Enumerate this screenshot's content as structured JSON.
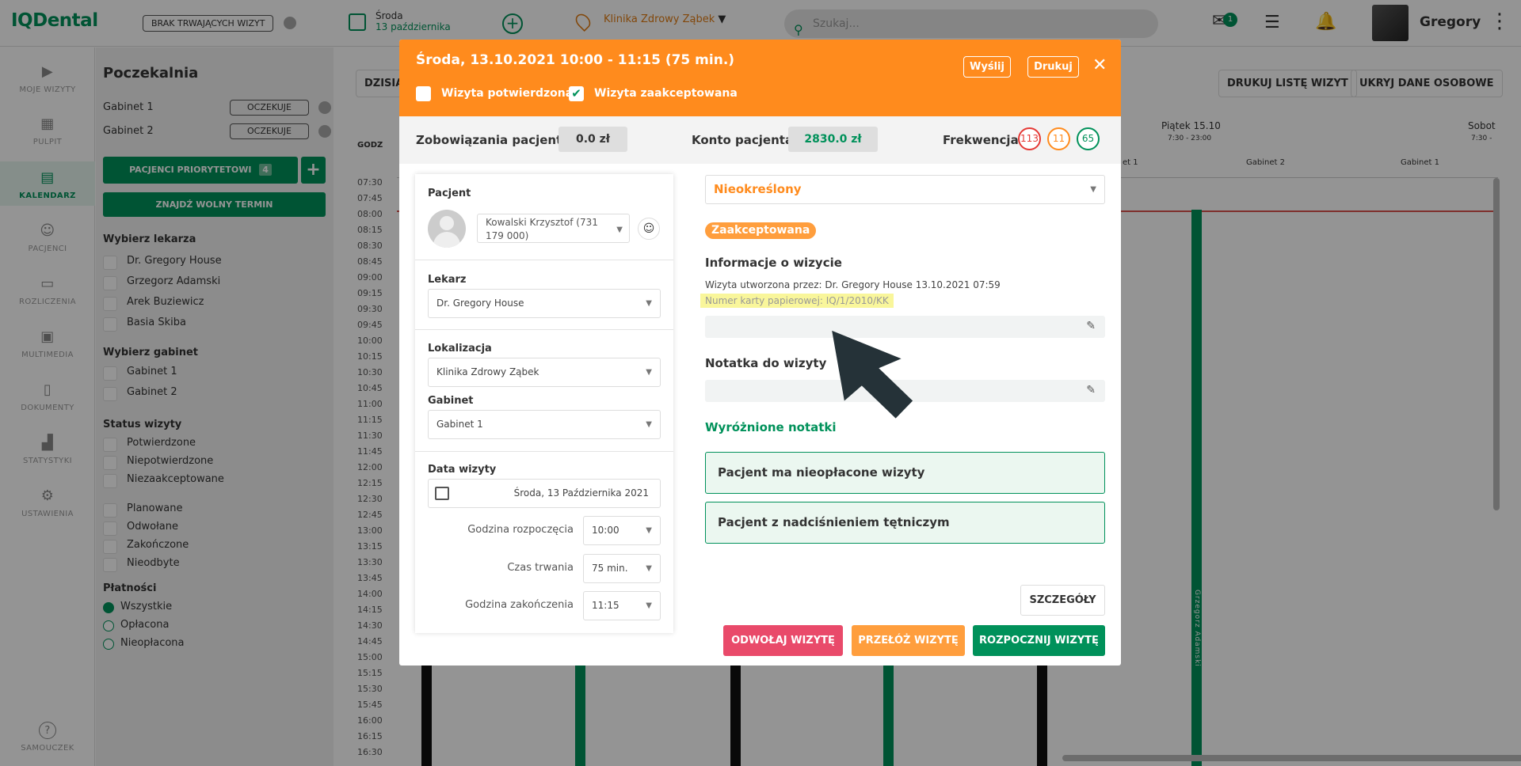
{
  "app": {
    "logo": "IQDental",
    "no_visits": "BRAK TRWAJĄCYCH WIZYT",
    "date_day": "Środa",
    "date_full": "13 października",
    "clinic": "Klinika Zdrowy Ząbek",
    "search_placeholder": "Szukaj...",
    "mail_count": "1",
    "user_name": "Gregory",
    "accent": "#00915a",
    "orange": "#ff8b1d"
  },
  "sidebar": {
    "items": [
      {
        "label": "MOJE WIZYTY",
        "icon": "play-icon"
      },
      {
        "label": "PULPIT",
        "icon": "dashboard-icon"
      },
      {
        "label": "KALENDARZ",
        "icon": "calendar-icon"
      },
      {
        "label": "PACJENCI",
        "icon": "patients-icon"
      },
      {
        "label": "ROZLICZENIA",
        "icon": "billing-icon"
      },
      {
        "label": "MULTIMEDIA",
        "icon": "media-icon"
      },
      {
        "label": "DOKUMENTY",
        "icon": "document-icon"
      },
      {
        "label": "STATYSTYKI",
        "icon": "stats-icon"
      },
      {
        "label": "USTAWIENIA",
        "icon": "gear-icon"
      }
    ],
    "help": "SAMOUCZEK"
  },
  "left_panel": {
    "title": "Poczekalnia",
    "rooms": [
      {
        "name": "Gabinet 1",
        "status": "OCZEKUJE"
      },
      {
        "name": "Gabinet 2",
        "status": "OCZEKUJE"
      }
    ],
    "priority_btn": "PACJENCI PRIORYTETOWI",
    "priority_count": "4",
    "free_btn": "ZNAJDŹ WOLNY TERMIN",
    "doctor_title": "Wybierz lekarza",
    "doctors": [
      "Dr. Gregory House",
      "Grzegorz Adamski",
      "Arek Buziewicz",
      "Basia Skiba"
    ],
    "room_title": "Wybierz gabinet",
    "room_filters": [
      "Gabinet 1",
      "Gabinet 2"
    ],
    "status_title": "Status wizyty",
    "statuses": [
      "Potwierdzone",
      "Niepotwierdzone",
      "Niezaakceptowane"
    ],
    "statuses2": [
      "Planowane",
      "Odwołane",
      "Zakończone",
      "Nieodbyte"
    ],
    "pay_title": "Płatności",
    "payments": [
      "Wszystkie",
      "Opłacona",
      "Nieopłacona"
    ]
  },
  "calendar": {
    "today_btn": "DZISIA",
    "godz": "GODZ",
    "print_btn": "DRUKUJ LISTĘ WIZYT",
    "hide_btn": "UKRYJ DANE OSOBOWE",
    "day_fri": "Piątek 15.10",
    "hours_fri": "7:30 - 23:00",
    "day_sat": "Sobot",
    "hours_sat": "7:30 -",
    "col1": "et 1",
    "col2": "Gabinet 2",
    "col3": "Gabinet 1",
    "vertical_name": "Grzegorz Adamski",
    "times": [
      "07:30",
      "07:45",
      "08:00",
      "08:15",
      "08:30",
      "08:45",
      "09:00",
      "09:15",
      "09:30",
      "09:45",
      "10:00",
      "10:15",
      "10:30",
      "10:45",
      "11:00",
      "11:15",
      "11:30",
      "11:45",
      "12:00",
      "12:15",
      "12:30",
      "12:45",
      "13:00",
      "13:15",
      "13:30",
      "13:45",
      "14:00",
      "14:15",
      "14:30",
      "14:45",
      "15:00",
      "15:15",
      "15:30",
      "15:45",
      "16:00",
      "16:15",
      "16:30"
    ]
  },
  "modal": {
    "title": "Środa, 13.10.2021 10:00 - 11:15 (75 min.)",
    "send": "Wyślij",
    "print": "Drukuj",
    "confirmed": "Wizyta potwierdzona",
    "accepted": "Wizyta zaakceptowana",
    "obligations_label": "Zobowiązania pacjenta",
    "obligations_value": "0.0 zł",
    "account_label": "Konto pacjenta",
    "account_value": "2830.0 zł",
    "attendance_label": "Frekwencja",
    "att_red": "113",
    "att_orange": "11",
    "att_green": "65",
    "patient_label": "Pacjent",
    "patient_value": "Kowalski Krzysztof (731 179 000)",
    "doctor_label": "Lekarz",
    "doctor_value": "Dr. Gregory House",
    "location_label": "Lokalizacja",
    "location_value": "Klinika Zdrowy Ząbek",
    "room_label": "Gabinet",
    "room_value": "Gabinet 1",
    "date_label": "Data wizyty",
    "date_value": "Środa, 13 Października 2021",
    "start_label": "Godzina rozpoczęcia",
    "start_value": "10:00",
    "duration_label": "Czas trwania",
    "duration_value": "75 min.",
    "end_label": "Godzina zakończenia",
    "end_value": "11:15",
    "type_value": "Nieokreślony",
    "status_badge": "Zaakceptowana",
    "info_title": "Informacje o wizycie",
    "created_by": "Wizyta utworzona przez: Dr. Gregory House 13.10.2021 07:59",
    "card_number": "Numer karty papierowej: IQ/1/2010/KK",
    "note_title": "Notatka do wizyty",
    "featured_title": "Wyróżnione notatki",
    "note1": "Pacjent ma nieopłacone wizyty",
    "note2": "Pacjent z nadciśnieniem tętniczym",
    "details_btn": "SZCZEGÓŁY",
    "cancel_btn": "ODWOŁAJ WIZYTĘ",
    "move_btn": "PRZEŁÓŻ WIZYTĘ",
    "start_btn": "ROZPOCZNIJ WIZYTĘ"
  }
}
